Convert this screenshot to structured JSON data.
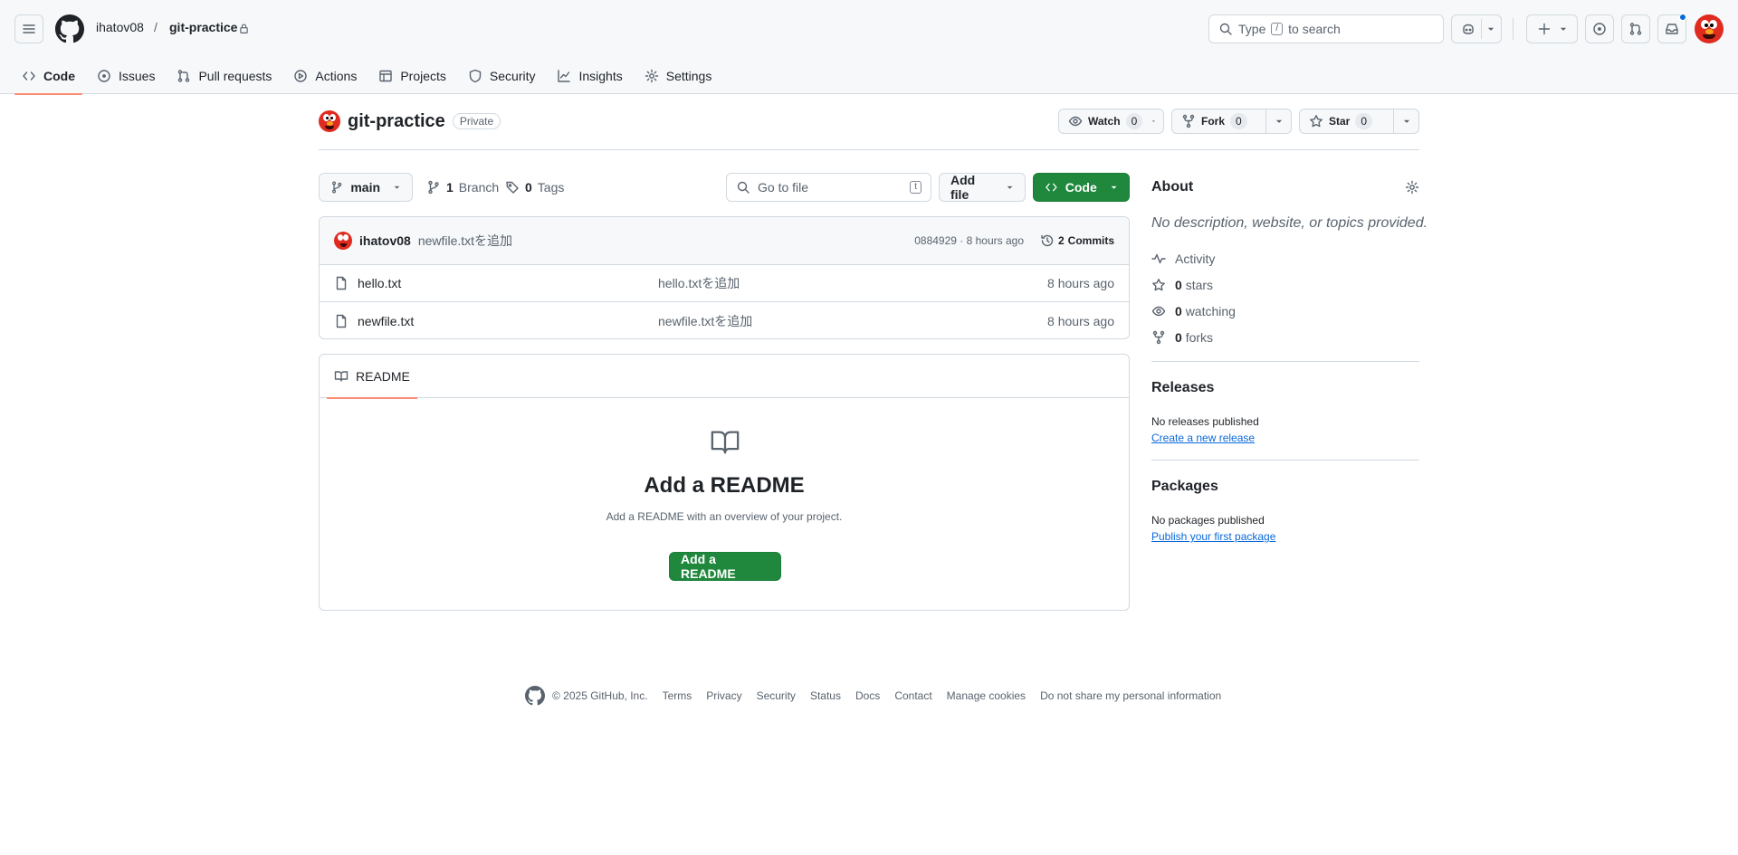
{
  "header": {
    "owner": "ihatov08",
    "separator": "/",
    "repo": "git-practice",
    "search_prefix": "Type",
    "search_key": "/",
    "search_suffix": "to search"
  },
  "tabs": [
    {
      "label": "Code"
    },
    {
      "label": "Issues"
    },
    {
      "label": "Pull requests"
    },
    {
      "label": "Actions"
    },
    {
      "label": "Projects"
    },
    {
      "label": "Security"
    },
    {
      "label": "Insights"
    },
    {
      "label": "Settings"
    }
  ],
  "repo": {
    "name": "git-practice",
    "visibility": "Private",
    "watch_label": "Watch",
    "watch_count": "0",
    "fork_label": "Fork",
    "fork_count": "0",
    "star_label": "Star",
    "star_count": "0"
  },
  "filenav": {
    "branch": "main",
    "branch_count": "1",
    "branch_label": "Branch",
    "tag_count": "0",
    "tag_label": "Tags",
    "goto_placeholder": "Go to file",
    "goto_key": "t",
    "add_file": "Add file",
    "code_button": "Code"
  },
  "commit": {
    "author": "ihatov08",
    "message": "newfile.txtを追加",
    "meta": "0884929 · 8 hours ago",
    "commits_count": "2",
    "commits_label": "Commits"
  },
  "files": [
    {
      "name": "hello.txt",
      "message": "hello.txtを追加",
      "age": "8 hours ago"
    },
    {
      "name": "newfile.txt",
      "message": "newfile.txtを追加",
      "age": "8 hours ago"
    }
  ],
  "readme": {
    "tab": "README",
    "heading": "Add a README",
    "description": "Add a README with an overview of your project.",
    "button": "Add a README"
  },
  "about": {
    "title": "About",
    "description": "No description, website, or topics provided.",
    "activity": "Activity",
    "stars_count": "0",
    "stars_label": "stars",
    "watching_count": "0",
    "watching_label": "watching",
    "forks_count": "0",
    "forks_label": "forks"
  },
  "releases": {
    "title": "Releases",
    "empty": "No releases published",
    "link": "Create a new release"
  },
  "packages": {
    "title": "Packages",
    "empty": "No packages published",
    "link": "Publish your first package"
  },
  "footer": {
    "copyright": "© 2025 GitHub, Inc.",
    "links": [
      "Terms",
      "Privacy",
      "Security",
      "Status",
      "Docs",
      "Contact",
      "Manage cookies",
      "Do not share my personal information"
    ]
  }
}
